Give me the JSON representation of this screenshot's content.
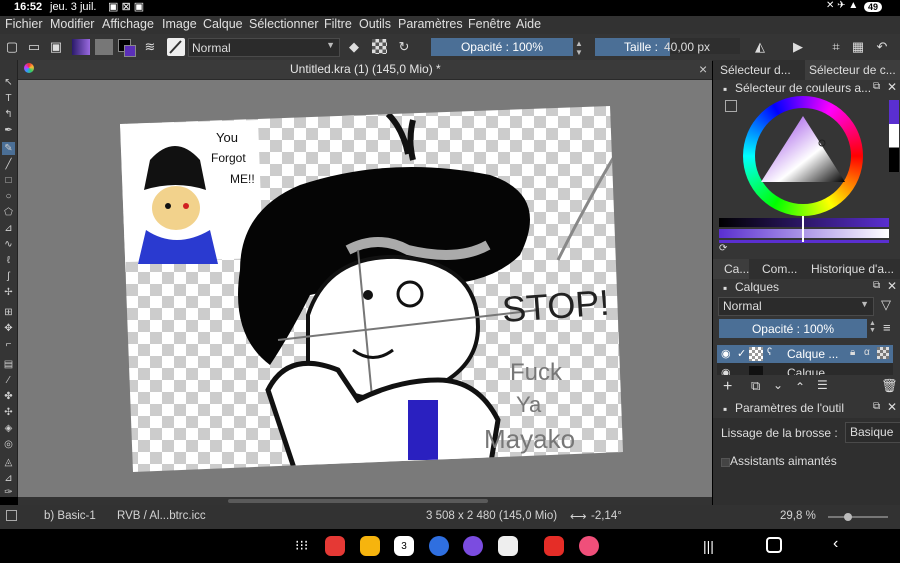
{
  "status": {
    "time": "16:52",
    "date": "jeu. 3 juil.",
    "battery": "49"
  },
  "menu": [
    "Fichier",
    "Modifier",
    "Affichage",
    "Image",
    "Calque",
    "Sélectionner",
    "Filtre",
    "Outils",
    "Paramètres",
    "Fenêtre",
    "Aide"
  ],
  "toolbar": {
    "blend_mode": "Normal",
    "opacity": "Opacité : 100%",
    "size_label": "Taille :",
    "size_value": "40,00 px"
  },
  "document": {
    "tab_title": "Untitled.kra (1) (145,0 Mio) *",
    "close": "×"
  },
  "artwork": {
    "inset_text": [
      "You",
      "Forgot",
      "ME!!"
    ],
    "stop_text": "STOP!",
    "graffiti": [
      "Fuck",
      "Ya",
      "Mayako"
    ]
  },
  "docker": {
    "tabs_top": [
      "Sélecteur d...",
      "Sélecteur de c..."
    ],
    "color_panel_title": "Sélecteur de couleurs a...",
    "tabs_mid": [
      "Ca...",
      "Com...",
      "Historique d'a..."
    ],
    "layers_title": "Calques",
    "layers_blend": "Normal",
    "layers_opacity": "Opacité :  100%",
    "layers": [
      {
        "name": "Calque ...",
        "visible": true,
        "active": true
      },
      {
        "name": "Calque",
        "visible": true,
        "active": false
      }
    ],
    "tool_options_title": "Paramètres de l'outil",
    "smoothing_label": "Lissage de la brosse :",
    "smoothing_value": "Basique",
    "assistants_label": "Assistants aimantés",
    "accent": "#4b6f96"
  },
  "bottom": {
    "brush": "b) Basic-1",
    "profile": "RVB / Al...btrc.icc",
    "dims": "3 508 x 2 480 (145,0 Mio)",
    "rotation": "-2,14°",
    "zoom": "29,8 %"
  }
}
